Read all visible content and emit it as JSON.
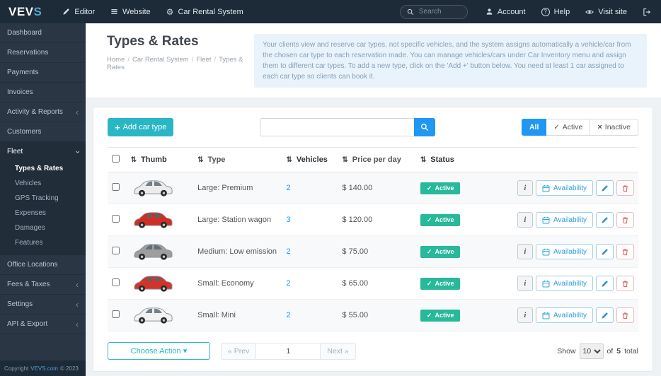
{
  "topbar": {
    "logo_text_1": "VEV",
    "logo_text_2": "S",
    "menu": [
      {
        "label": "Editor"
      },
      {
        "label": "Website"
      },
      {
        "label": "Car Rental System"
      }
    ],
    "search_placeholder": "Search",
    "account_label": "Account",
    "help_label": "Help",
    "visit_site_label": "Visit site"
  },
  "sidebar": {
    "items_upper": [
      {
        "label": "Dashboard",
        "chevron": ""
      },
      {
        "label": "Reservations",
        "chevron": ""
      },
      {
        "label": "Payments",
        "chevron": ""
      },
      {
        "label": "Invoices",
        "chevron": ""
      },
      {
        "label": "Activity & Reports",
        "chevron": "left"
      },
      {
        "label": "Customers",
        "chevron": ""
      },
      {
        "label": "Fleet",
        "chevron": "down",
        "open": true
      }
    ],
    "submenu": [
      {
        "label": "Types & Rates",
        "active": true
      },
      {
        "label": "Vehicles",
        "active": false
      },
      {
        "label": "GPS Tracking",
        "active": false
      },
      {
        "label": "Expenses",
        "active": false
      },
      {
        "label": "Damages",
        "active": false
      },
      {
        "label": "Features",
        "active": false
      }
    ],
    "items_lower": [
      {
        "label": "Office Locations",
        "chevron": ""
      },
      {
        "label": "Fees & Taxes",
        "chevron": "left"
      },
      {
        "label": "Settings",
        "chevron": "left"
      },
      {
        "label": "API & Export",
        "chevron": "left"
      }
    ]
  },
  "footer": {
    "copyright_prefix": "Copyright",
    "site_link": "VEVS.com",
    "copyright_suffix": "© 2023"
  },
  "page": {
    "title": "Types & Rates",
    "breadcrumb": [
      "Home",
      "Car Rental System",
      "Fleet",
      "Types & Rates"
    ],
    "info_text": "Your clients view and reserve car types, not specific vehicles, and the system assigns automatically a vehicle/car from the chosen car type to each reservation made. You can manage vehicles/cars under Car Inventory menu and assign them to different car types. To add a new type, click on the 'Add +' button below. You need at least 1 car assigned to each car type so clients can book it."
  },
  "toolbar": {
    "add_label": "Add car type",
    "search_value": "",
    "filter_all": "All",
    "filter_active": "Active",
    "filter_inactive": "Inactive"
  },
  "table": {
    "headers": {
      "thumb": "Thumb",
      "type": "Type",
      "vehicles": "Vehicles",
      "price": "Price per day",
      "status": "Status"
    },
    "availability_label": "Availability",
    "rows": [
      {
        "type": "Large: Premium",
        "vehicles": "2",
        "price": "$ 140.00",
        "status": "Active",
        "car_color": "#ececec"
      },
      {
        "type": "Large: Station wagon",
        "vehicles": "3",
        "price": "$ 120.00",
        "status": "Active",
        "car_color": "#cf2e24"
      },
      {
        "type": "Medium: Low emission",
        "vehicles": "2",
        "price": "$ 75.00",
        "status": "Active",
        "car_color": "#9e9e9e"
      },
      {
        "type": "Small: Economy",
        "vehicles": "2",
        "price": "$ 65.00",
        "status": "Active",
        "car_color": "#d2342a"
      },
      {
        "type": "Small: Mini",
        "vehicles": "2",
        "price": "$ 55.00",
        "status": "Active",
        "car_color": "#f2f2f2"
      }
    ]
  },
  "card_footer": {
    "choose_action": "Choose Action",
    "prev": "« Prev",
    "page": "1",
    "next": "Next »",
    "show_label": "Show",
    "show_value": "10",
    "of_label": "of",
    "total_count": "5",
    "total_label": "total"
  },
  "colors": {
    "accent_teal": "#29b7c6",
    "accent_blue": "#2097f3",
    "status_green": "#26b99a",
    "danger_red": "#d9534f",
    "topbar_bg": "#1d2a37",
    "sidebar_bg": "#2a3644"
  }
}
